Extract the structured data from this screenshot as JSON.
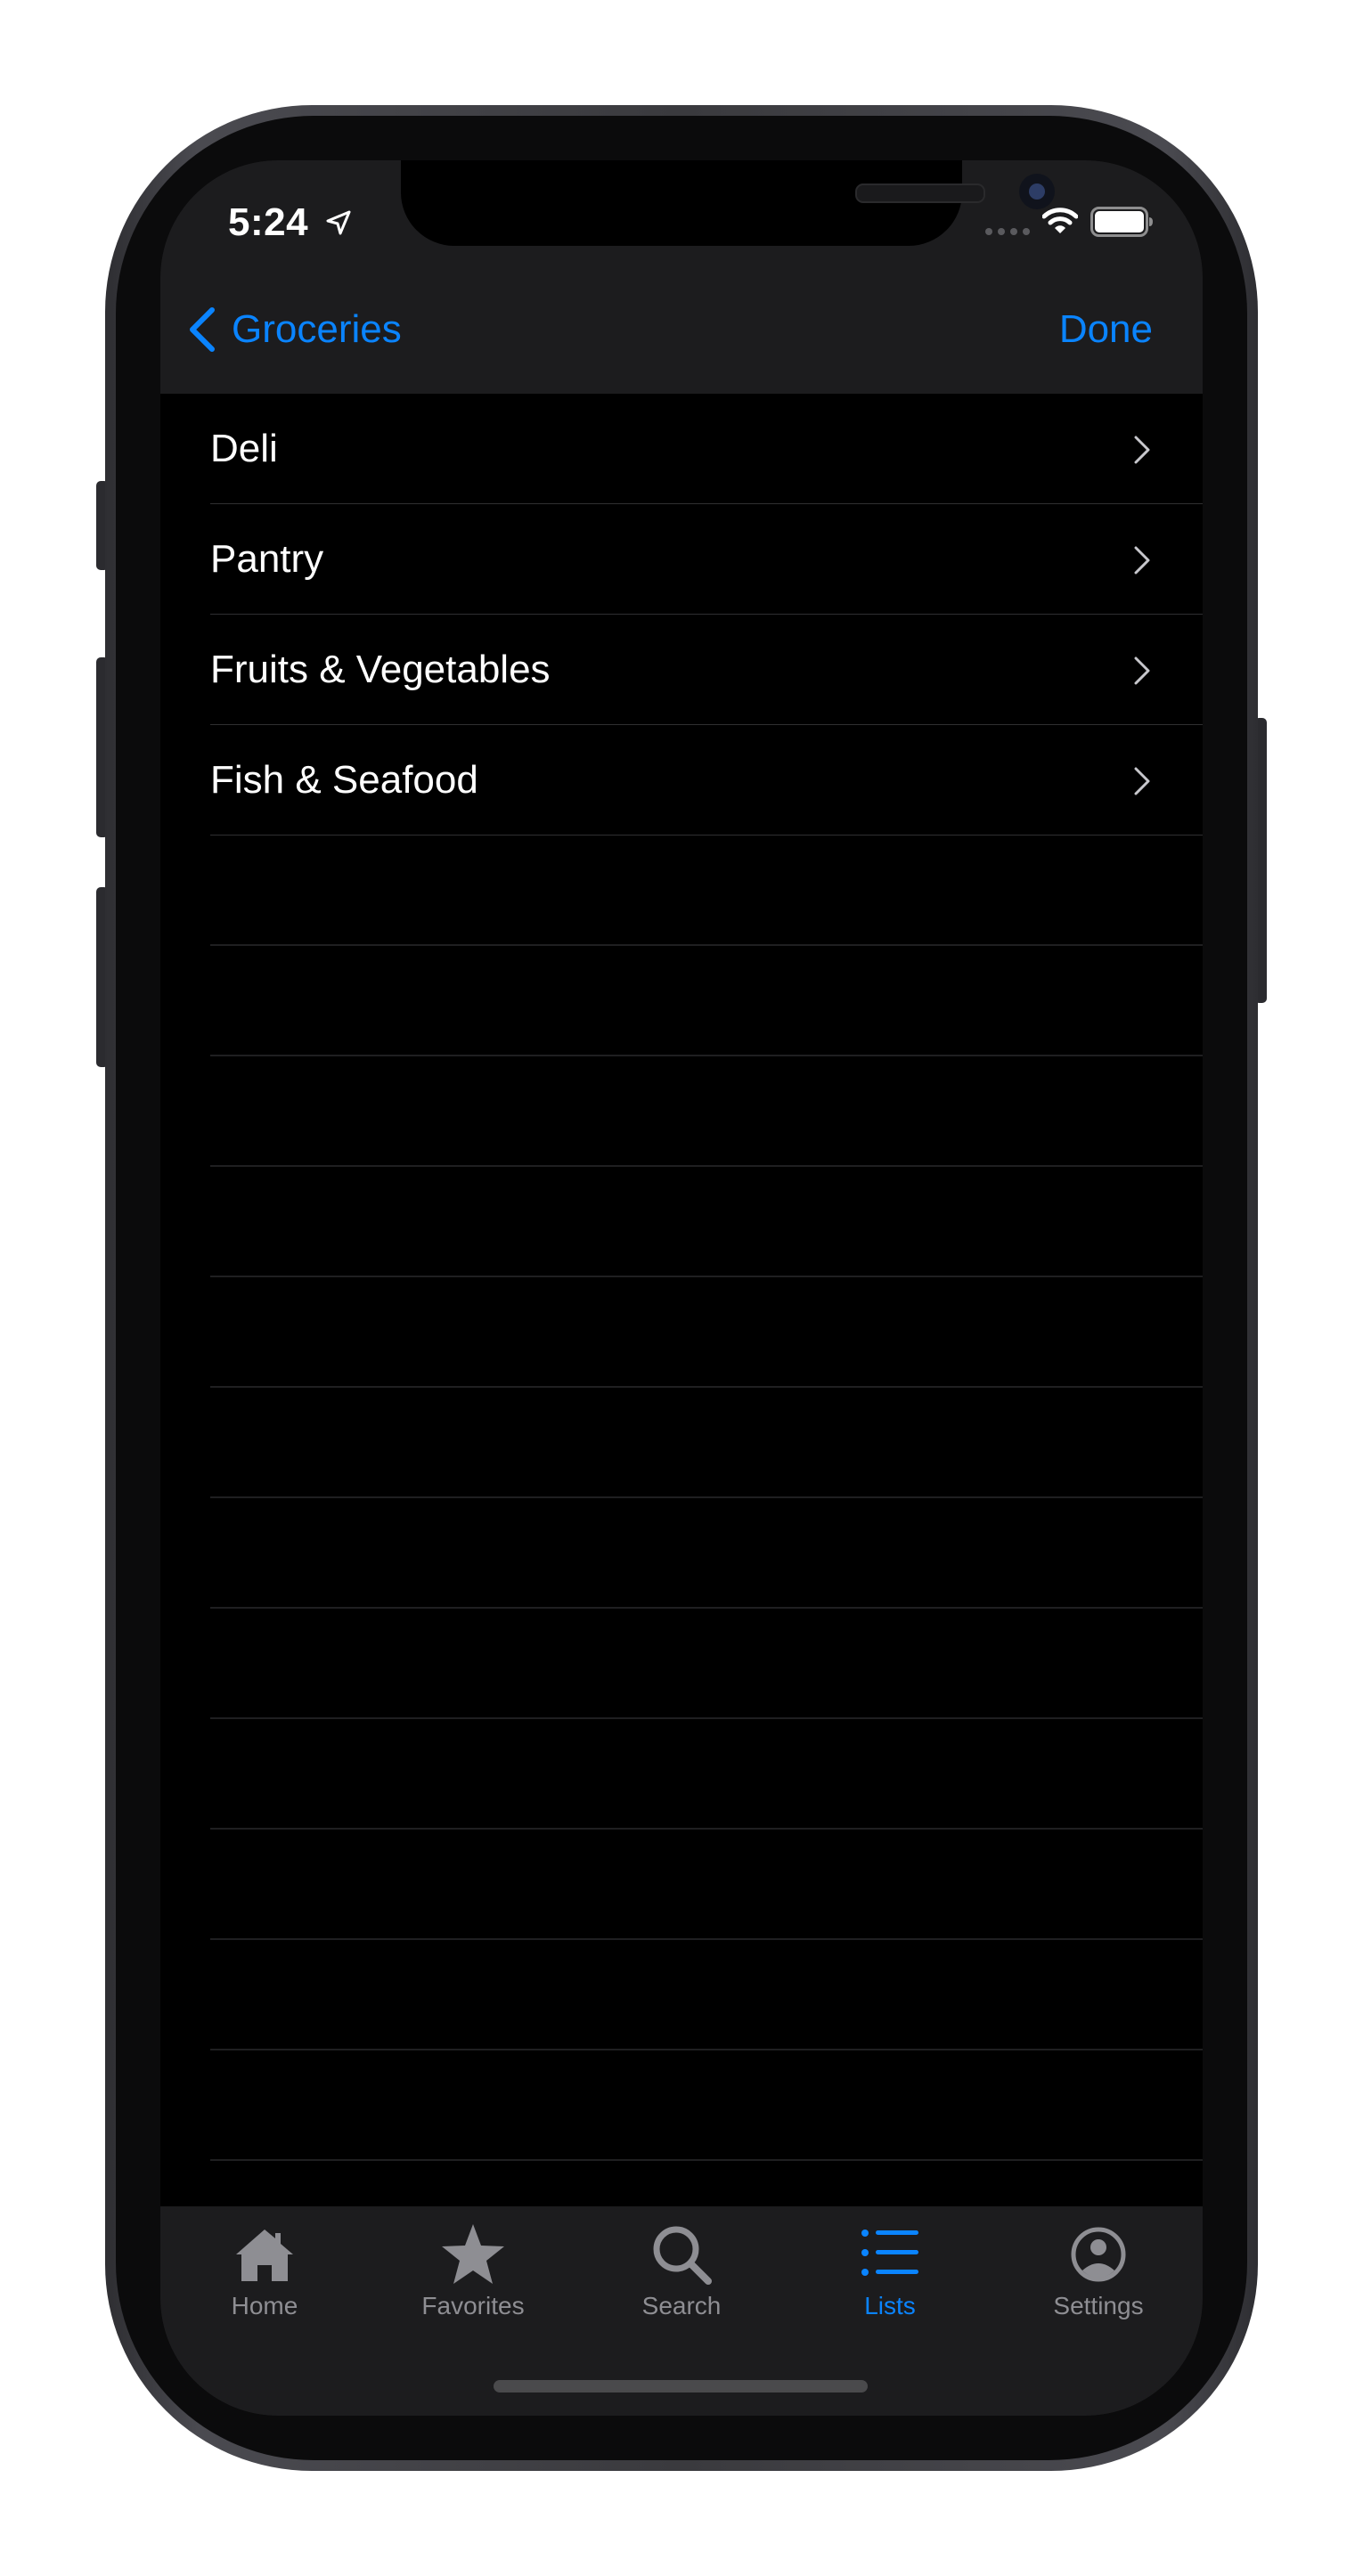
{
  "status_bar": {
    "time": "5:24",
    "icons": [
      "location-arrow-icon",
      "cell-signal-icon",
      "wifi-icon",
      "battery-icon"
    ]
  },
  "nav": {
    "back_label": "Groceries",
    "done_label": "Done"
  },
  "list": {
    "items": [
      {
        "label": "Deli"
      },
      {
        "label": "Pantry"
      },
      {
        "label": "Fruits & Vegetables"
      },
      {
        "label": "Fish & Seafood"
      }
    ]
  },
  "tabbar": {
    "tabs": [
      {
        "label": "Home",
        "icon": "house-icon"
      },
      {
        "label": "Favorites",
        "icon": "star-icon"
      },
      {
        "label": "Search",
        "icon": "magnifying-glass-icon"
      },
      {
        "label": "Lists",
        "icon": "list-icon",
        "active": true
      },
      {
        "label": "Settings",
        "icon": "person-circle-icon"
      }
    ]
  },
  "colors": {
    "accent": "#0a84ff",
    "background": "#000000",
    "bar_background": "#1c1c1e",
    "inactive_tab": "#8e8e93"
  }
}
